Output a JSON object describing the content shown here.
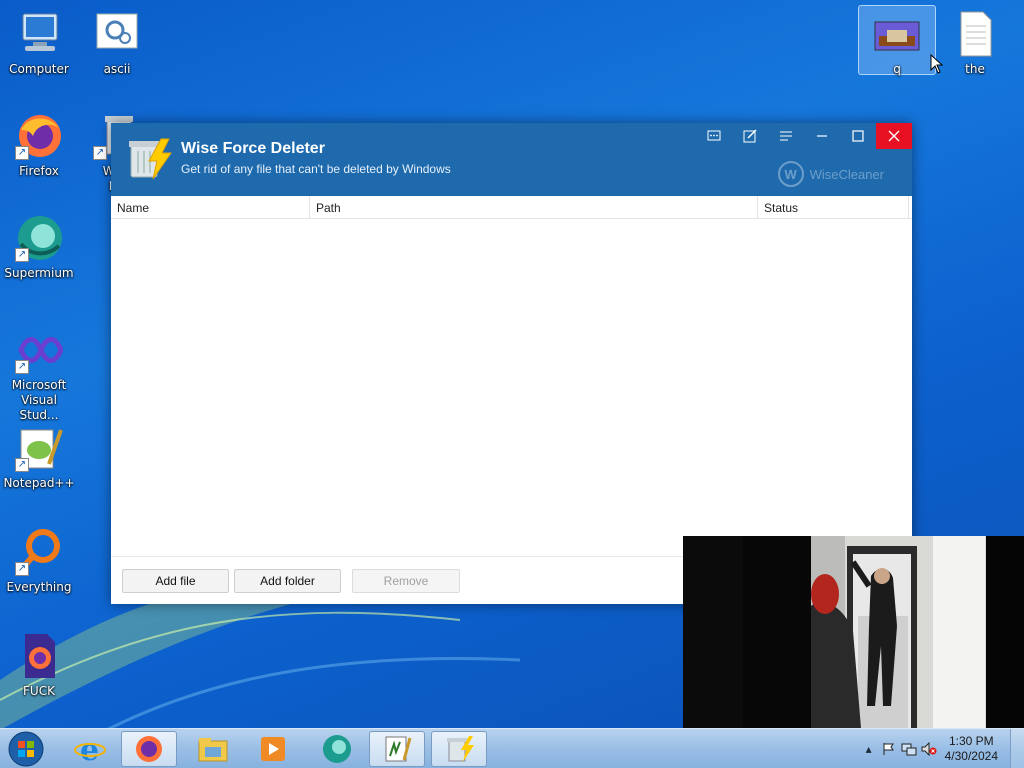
{
  "desktop": {
    "icons": [
      {
        "label": "Computer",
        "icon": "computer-icon"
      },
      {
        "label": "ascii",
        "icon": "settings-document-icon"
      },
      {
        "label": "q",
        "icon": "image-file-icon"
      },
      {
        "label": "the",
        "icon": "text-file-icon"
      },
      {
        "label": "Firefox",
        "icon": "firefox-icon"
      },
      {
        "label": "Wise",
        "label2": "De",
        "icon": "wise-force-deleter-icon"
      },
      {
        "label": "Supermium",
        "icon": "supermium-icon"
      },
      {
        "label": "Microsoft",
        "label2": "Visual Stud...",
        "icon": "visual-studio-icon"
      },
      {
        "label": "Notepad++",
        "icon": "notepadpp-icon"
      },
      {
        "label": "Everything",
        "icon": "everything-search-icon"
      },
      {
        "label": "FUCK",
        "icon": "firefox-file-icon"
      }
    ]
  },
  "window": {
    "title": "Wise Force Deleter",
    "subtitle": "Get rid of any file that can't be deleted by Windows",
    "brand": "WiseCleaner",
    "brand_letter": "W",
    "controls": [
      "feedback-icon",
      "edit-icon",
      "menu-icon",
      "minimize-icon",
      "maximize-icon",
      "close-icon"
    ],
    "columns": {
      "name": "Name",
      "path": "Path",
      "status": "Status"
    },
    "rows": [],
    "buttons": {
      "add_file": "Add file",
      "add_folder": "Add folder",
      "remove": "Remove"
    }
  },
  "taskbar": {
    "items": [
      "ie-icon",
      "firefox-icon",
      "file-explorer-icon",
      "media-player-icon",
      "supermium-icon",
      "app-icon",
      "wise-force-deleter-icon"
    ],
    "clock": {
      "time": "1:30 PM",
      "date": "4/30/2024"
    }
  },
  "colors": {
    "titlebar": "#1e6aad",
    "close": "#e81123",
    "desktop": "#1677db"
  }
}
